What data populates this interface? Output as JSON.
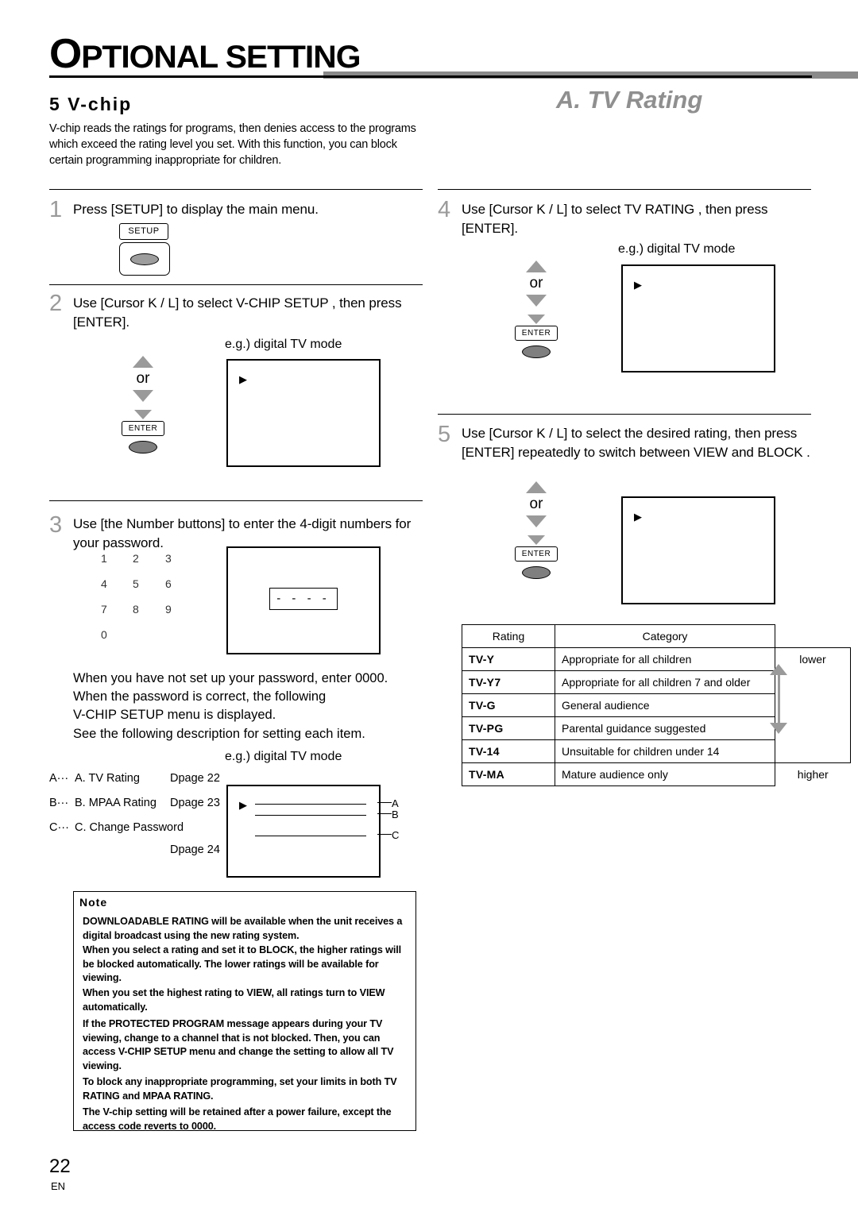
{
  "header": {
    "title_first": "O",
    "title_rest": "PTIONAL SETTING"
  },
  "section": {
    "number_label": "5  V-chip",
    "right_title": "A. TV Rating",
    "intro": "V-chip reads the ratings for programs, then denies access to the programs which exceed the rating level you set. With this function, you can block certain programming inappropriate for children."
  },
  "steps": [
    {
      "num": "1",
      "text": "Press [SETUP] to display the main menu."
    },
    {
      "num": "2",
      "text": "Use [Cursor K / L] to select  V-CHIP SETUP , then press [ENTER]."
    },
    {
      "num": "3",
      "text": "Use [the Number buttons] to enter the 4-digit numbers for your password."
    },
    {
      "num": "4",
      "text": "Use [Cursor K / L] to select  TV RATING , then press [ENTER]."
    },
    {
      "num": "5",
      "text": "Use [Cursor K / L] to select the desired rating, then press [ENTER] repeatedly to switch between  VIEW  and  BLOCK ."
    }
  ],
  "labels": {
    "eg_digital_tv": "e.g.) digital TV mode",
    "or": "or",
    "enter": "ENTER",
    "setup": "SETUP",
    "dashes": "- - - -"
  },
  "numpad": [
    "1",
    "2",
    "3",
    "4",
    "5",
    "6",
    "7",
    "8",
    "9",
    "0"
  ],
  "password_note": {
    "line1": "When you have not set up your password, enter 0000.",
    "line2": "When the password is correct, the following",
    "line3": "V-CHIP SETUP  menu is displayed.",
    "line4": "See the following description for setting each item."
  },
  "item_list": [
    {
      "key": "A···",
      "label": "A. TV Rating",
      "page": "Dpage 22",
      "marker": "A"
    },
    {
      "key": "B···",
      "label": "B. MPAA Rating",
      "page": "Dpage 23",
      "marker": "B"
    },
    {
      "key": "C···",
      "label": "C. Change Password",
      "page": "Dpage 24",
      "marker": "C"
    }
  ],
  "note": {
    "title": "Note",
    "lines": [
      "DOWNLOADABLE RATING will be available when the unit receives a digital broadcast using the new rating system.",
      "When you select a rating and set it to BLOCK, the higher ratings will be blocked automatically. The lower ratings will be available for viewing.",
      "When you set the highest rating to VIEW, all ratings turn to VIEW automatically.",
      "If the PROTECTED PROGRAM message appears during your TV viewing, change to a channel that is not blocked. Then, you can access V-CHIP SETUP menu and change the setting to allow all TV viewing.",
      "To block any inappropriate programming, set your limits in both TV RATING and MPAA RATING.",
      "The V-chip setting will be retained after a power failure, except the access code reverts to 0000."
    ]
  },
  "rating_table": {
    "headers": [
      "Rating",
      "Category",
      ""
    ],
    "scale_low": "lower",
    "scale_high": "higher",
    "rows": [
      {
        "rating": "TV-Y",
        "category": "Appropriate for all children"
      },
      {
        "rating": "TV-Y7",
        "category": "Appropriate for all children 7 and older"
      },
      {
        "rating": "TV-G",
        "category": "General audience"
      },
      {
        "rating": "TV-PG",
        "category": "Parental guidance suggested"
      },
      {
        "rating": "TV-14",
        "category": "Unsuitable for children under 14"
      },
      {
        "rating": "TV-MA",
        "category": "Mature audience only"
      }
    ]
  },
  "footer": {
    "page": "22",
    "lang": "EN"
  }
}
